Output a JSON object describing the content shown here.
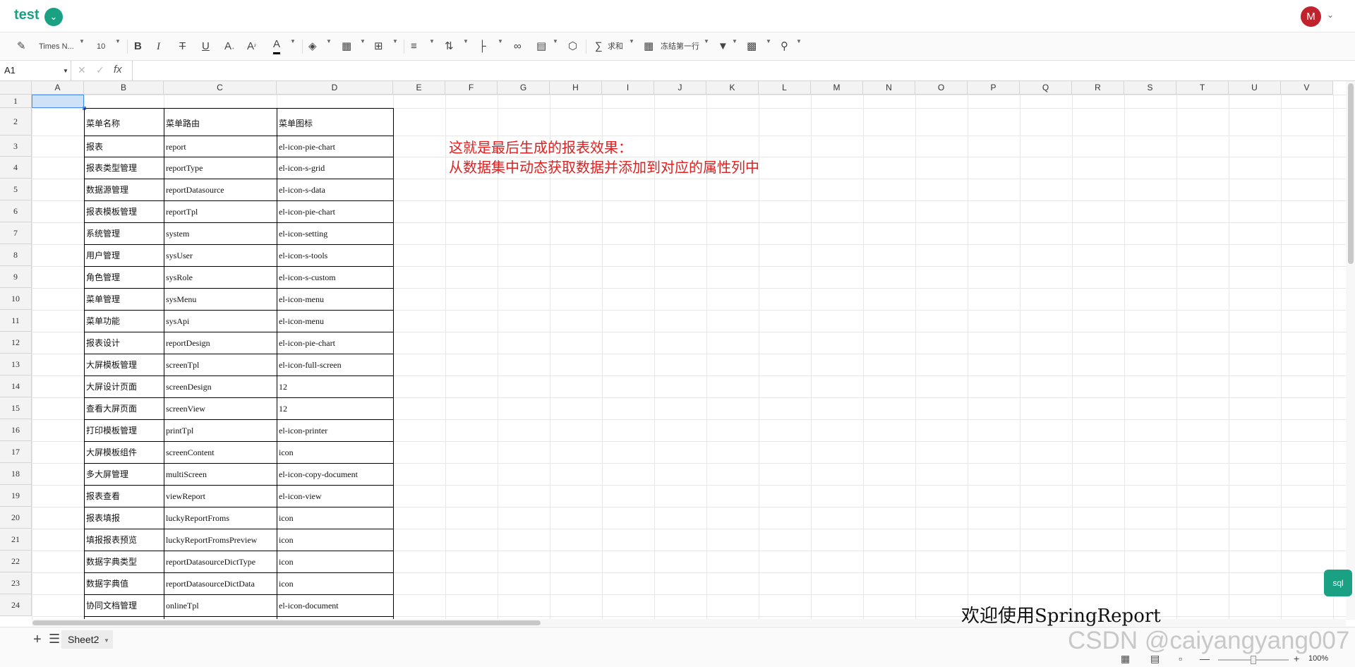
{
  "header": {
    "title": "test",
    "title_dropdown_icon": "chevron-down-icon",
    "avatar_letter": "M",
    "accent": "#1aa184",
    "avatar_color": "#c0232c"
  },
  "toolbar": {
    "font": "Times N...",
    "size": "10",
    "bold": "B",
    "italic": "I",
    "strike": "T",
    "underline": "U",
    "sub": "A",
    "sup": "A",
    "text_color": "A",
    "sum_label": "求和",
    "freeze_label": "冻结第一行"
  },
  "formula_bar": {
    "cell_ref": "A1",
    "fx": "fx"
  },
  "columns": [
    "A",
    "B",
    "C",
    "D",
    "E",
    "F",
    "G",
    "H",
    "I",
    "J",
    "K",
    "L",
    "M",
    "N",
    "O",
    "P",
    "Q",
    "R",
    "S",
    "T",
    "U",
    "V"
  ],
  "rows": [
    "1",
    "2",
    "3",
    "4",
    "5",
    "6",
    "7",
    "8",
    "9",
    "10",
    "11",
    "12",
    "13",
    "14",
    "15",
    "16",
    "17",
    "18",
    "19",
    "20",
    "21",
    "22",
    "23",
    "24"
  ],
  "table": {
    "headers": [
      "菜单名称",
      "菜单路由",
      "菜单图标"
    ],
    "rows": [
      [
        "报表",
        "report",
        "el-icon-pie-chart"
      ],
      [
        "报表类型管理",
        "reportType",
        "el-icon-s-grid"
      ],
      [
        "数据源管理",
        "reportDatasource",
        "el-icon-s-data"
      ],
      [
        "报表模板管理",
        "reportTpl",
        "el-icon-pie-chart"
      ],
      [
        "系统管理",
        "system",
        "el-icon-setting"
      ],
      [
        "用户管理",
        "sysUser",
        "el-icon-s-tools"
      ],
      [
        "角色管理",
        "sysRole",
        "el-icon-s-custom"
      ],
      [
        "菜单管理",
        "sysMenu",
        "el-icon-menu"
      ],
      [
        "菜单功能",
        "sysApi",
        "el-icon-menu"
      ],
      [
        "报表设计",
        "reportDesign",
        "el-icon-pie-chart"
      ],
      [
        "大屏模板管理",
        "screenTpl",
        "el-icon-full-screen"
      ],
      [
        "大屏设计页面",
        "screenDesign",
        "12"
      ],
      [
        "查看大屏页面",
        "screenView",
        "12"
      ],
      [
        "打印模板管理",
        "printTpl",
        "el-icon-printer"
      ],
      [
        "大屏模板组件",
        "screenContent",
        "icon"
      ],
      [
        "多大屏管理",
        "multiScreen",
        "el-icon-copy-document"
      ],
      [
        "报表查看",
        "viewReport",
        "el-icon-view"
      ],
      [
        "报表填报",
        "luckyReportFroms",
        "icon"
      ],
      [
        "填报报表预览",
        "luckyReportFromsPreview",
        "icon"
      ],
      [
        "数据字典类型",
        "reportDatasourceDictType",
        "icon"
      ],
      [
        "数据字典值",
        "reportDatasourceDictData",
        "icon"
      ],
      [
        "协同文档管理",
        "onlineTpl",
        "el-icon-document"
      ]
    ]
  },
  "note": {
    "line1": "这就是最后生成的报表效果：",
    "line2": "从数据集中动态获取数据并添加到对应的属性列中",
    "color": "#e02020"
  },
  "sql_button": "sql",
  "welcome": "欢迎使用SpringReport",
  "sheet": {
    "name": "Sheet2"
  },
  "status": {
    "zoom": "100%"
  },
  "watermark": "CSDN @caiyangyang007"
}
